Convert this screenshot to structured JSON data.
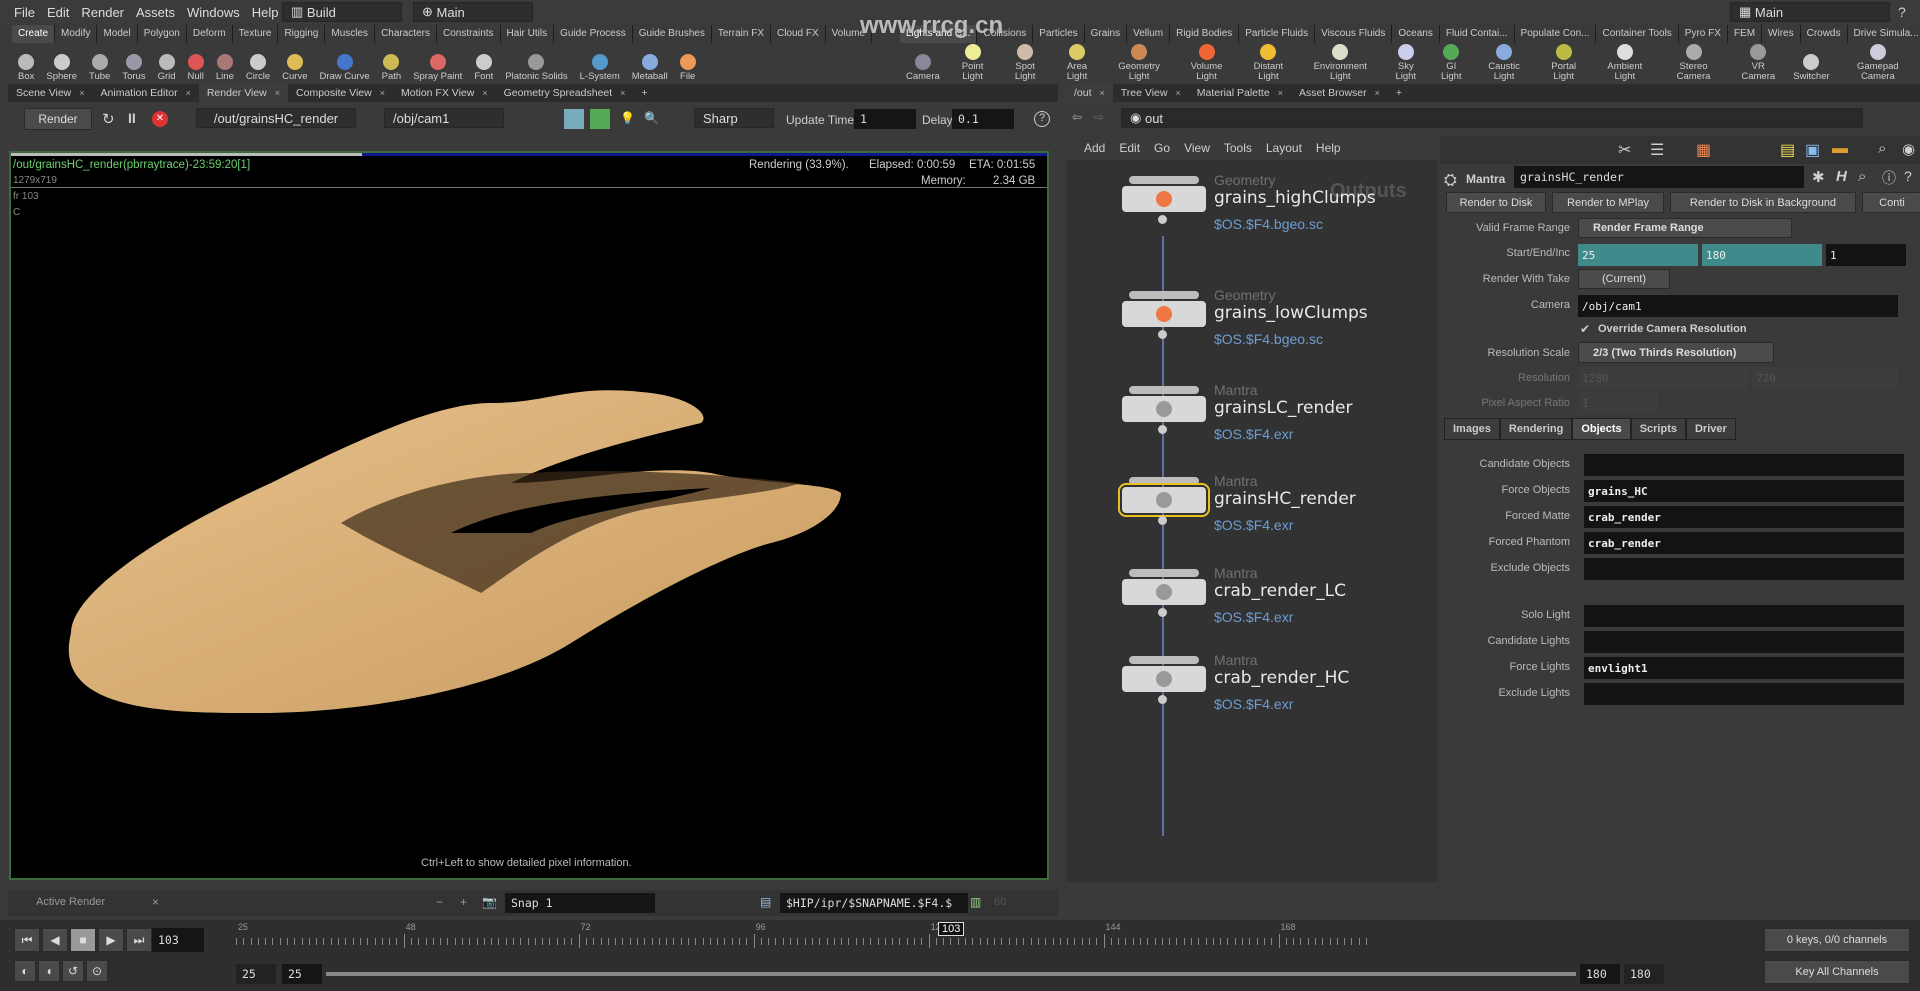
{
  "menu": [
    "File",
    "Edit",
    "Render",
    "Assets",
    "Windows",
    "Help"
  ],
  "desktop": "Build",
  "main_left": "Main",
  "main_right": "Main",
  "shelf_tabs_left": [
    "Create",
    "Modify",
    "Model",
    "Polygon",
    "Deform",
    "Texture",
    "Rigging",
    "Muscles",
    "Characters",
    "Constraints",
    "Hair Utils",
    "Guide Process",
    "Guide Brushes",
    "Terrain FX",
    "Cloud FX",
    "Volume"
  ],
  "shelf_tools_left": [
    "Box",
    "Sphere",
    "Tube",
    "Torus",
    "Grid",
    "Null",
    "Line",
    "Circle",
    "Curve",
    "Draw Curve",
    "Path",
    "Spray Paint",
    "Font",
    "Platonic Solids",
    "L-System",
    "Metaball",
    "File"
  ],
  "shelf_tabs_right": [
    "Lights and C...",
    "Collisions",
    "Particles",
    "Grains",
    "Vellum",
    "Rigid Bodies",
    "Particle Fluids",
    "Viscous Fluids",
    "Oceans",
    "Fluid Contai...",
    "Populate Con...",
    "Container Tools",
    "Pyro FX",
    "FEM",
    "Wires",
    "Crowds",
    "Drive Simula..."
  ],
  "shelf_tools_right": [
    "Camera",
    "Point Light",
    "Spot Light",
    "Area Light",
    "Geometry Light",
    "Volume Light",
    "Distant Light",
    "Environment Light",
    "Sky Light",
    "GI Light",
    "Caustic Light",
    "Portal Light",
    "Ambient Light",
    "Stereo Camera",
    "VR Camera",
    "Switcher",
    "Gamepad Camera"
  ],
  "watermark": "www.rrcg.cn",
  "left_tabs": [
    "Scene View",
    "Animation Editor",
    "Render View",
    "Composite View",
    "Motion FX View",
    "Geometry Spreadsheet"
  ],
  "right_tabs": [
    "/out",
    "Tree View",
    "Material Palette",
    "Asset Browser"
  ],
  "render_toolbar": {
    "render": "Render",
    "rop": "/out/grainsHC_render",
    "camera": "/obj/cam1",
    "mode": "Sharp",
    "update_label": "Update Time",
    "update_value": "1",
    "delay_label": "Delay",
    "delay_value": "0.1"
  },
  "viewport": {
    "title": "/out/grainsHC_render(pbrraytrace)-23:59:20[1]",
    "res": "1279x719",
    "frame": "fr 103",
    "channel": "C",
    "status": "Rendering (33.9%).",
    "elapsed": "Elapsed: 0:00:59",
    "eta": "ETA: 0:01:55",
    "memory_label": "Memory:",
    "memory": "2.34 GB",
    "hint": "Ctrl+Left to show detailed pixel information.",
    "progress": 33.9
  },
  "render_bar": {
    "active": "Active Render",
    "snap": "Snap 1",
    "path": "$HIP/ipr/$SNAPNAME.$F4.$",
    "num": "60"
  },
  "path": "out",
  "net_menu": [
    "Add",
    "Edit",
    "Go",
    "View",
    "Tools",
    "Layout",
    "Help"
  ],
  "net_label": "Outputs",
  "nodes": [
    {
      "type": "Geometry",
      "name": "grains_highClumps",
      "file": "$OS.$F4.bgeo.sc"
    },
    {
      "type": "Geometry",
      "name": "grains_lowClumps",
      "file": "$OS.$F4.bgeo.sc"
    },
    {
      "type": "Mantra",
      "name": "grainsLC_render",
      "file": "$OS.$F4.exr"
    },
    {
      "type": "Mantra",
      "name": "grainsHC_render",
      "file": "$OS.$F4.exr"
    },
    {
      "type": "Mantra",
      "name": "crab_render_LC",
      "file": "$OS.$F4.exr"
    },
    {
      "type": "Mantra",
      "name": "crab_render_HC",
      "file": "$OS.$F4.exr"
    }
  ],
  "params": {
    "node_type": "Mantra",
    "node_name": "grainsHC_render",
    "buttons": [
      "Render to Disk",
      "Render to MPlay",
      "Render to Disk in Background",
      "Conti"
    ],
    "valid_frame_range_label": "Valid Frame Range",
    "valid_frame_range": "Render Frame Range",
    "start_end_inc_label": "Start/End/Inc",
    "start": "25",
    "end": "180",
    "inc": "1",
    "take_label": "Render With Take",
    "take": "(Current)",
    "camera_label": "Camera",
    "camera": "/obj/cam1",
    "override_label": "Override Camera Resolution",
    "res_scale_label": "Resolution Scale",
    "res_scale": "2/3 (Two Thirds Resolution)",
    "resolution_label": "Resolution",
    "res_x": "1280",
    "res_y": "720",
    "par_label": "Pixel Aspect Ratio",
    "par": "1",
    "tabs": [
      "Images",
      "Rendering",
      "Objects",
      "Scripts",
      "Driver"
    ],
    "objects": [
      [
        "Candidate Objects",
        ""
      ],
      [
        "Force Objects",
        "grains_HC"
      ],
      [
        "Forced Matte",
        "crab_render"
      ],
      [
        "Forced Phantom",
        "crab_render"
      ],
      [
        "Exclude Objects",
        ""
      ]
    ],
    "lights": [
      [
        "Solo Light",
        ""
      ],
      [
        "Candidate Lights",
        ""
      ],
      [
        "Force Lights",
        "envlight1"
      ],
      [
        "Exclude Lights",
        ""
      ]
    ]
  },
  "timeline": {
    "frame": "103",
    "ticks": [
      "25",
      "48",
      "72",
      "96",
      "120",
      "144",
      "168"
    ],
    "range_start": "25",
    "range_start2": "25",
    "range_end": "180",
    "range_end2": "180",
    "keys": "0 keys, 0/0 channels",
    "key_all": "Key All Channels"
  },
  "colors": {
    "accent_teal": "#3f8a8a",
    "node_file": "#6f9cd0",
    "selected_node": "#e8c020",
    "sand": "#d9b27c"
  }
}
